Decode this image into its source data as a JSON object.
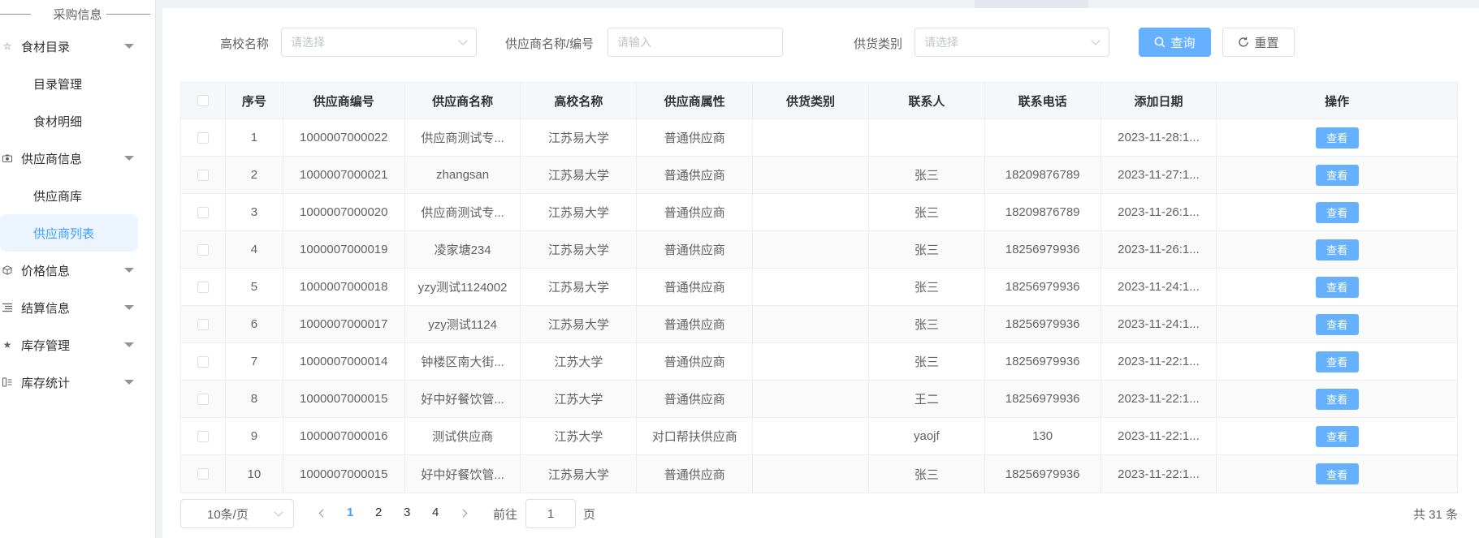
{
  "sidebar": {
    "group_title": "采购信息",
    "menus": [
      {
        "label": "食材目录",
        "icon": "star-outline-icon",
        "children": [
          "目录管理",
          "食材明细"
        ]
      },
      {
        "label": "供应商信息",
        "icon": "camera-icon",
        "children": [
          "供应商库",
          "供应商列表"
        ]
      },
      {
        "label": "价格信息",
        "icon": "cube-icon",
        "children": []
      },
      {
        "label": "结算信息",
        "icon": "list-icon",
        "children": []
      },
      {
        "label": "库存管理",
        "icon": "star-filled-icon",
        "children": []
      },
      {
        "label": "库存统计",
        "icon": "chart-icon",
        "children": []
      }
    ],
    "active_item": "供应商列表"
  },
  "filters": {
    "school_label": "高校名称",
    "school_placeholder": "请选择",
    "supplier_label": "供应商名称/编号",
    "supplier_placeholder": "请输入",
    "category_label": "供货类别",
    "category_placeholder": "请选择",
    "query_label": "查询",
    "reset_label": "重置"
  },
  "table": {
    "headers": [
      "序号",
      "供应商编号",
      "供应商名称",
      "高校名称",
      "供应商属性",
      "供货类别",
      "联系人",
      "联系电话",
      "添加日期",
      "操作"
    ],
    "action_label": "查看",
    "rows": [
      [
        "1",
        "1000007000022",
        "供应商测试专...",
        "江苏易大学",
        "普通供应商",
        "",
        "",
        "",
        "2023-11-28:1..."
      ],
      [
        "2",
        "1000007000021",
        "zhangsan",
        "江苏易大学",
        "普通供应商",
        "",
        "张三",
        "18209876789",
        "2023-11-27:1..."
      ],
      [
        "3",
        "1000007000020",
        "供应商测试专...",
        "江苏易大学",
        "普通供应商",
        "",
        "张三",
        "18209876789",
        "2023-11-26:1..."
      ],
      [
        "4",
        "1000007000019",
        "凌家塘234",
        "江苏易大学",
        "普通供应商",
        "",
        "张三",
        "18256979936",
        "2023-11-26:1..."
      ],
      [
        "5",
        "1000007000018",
        "yzy测试1124002",
        "江苏易大学",
        "普通供应商",
        "",
        "张三",
        "18256979936",
        "2023-11-24:1..."
      ],
      [
        "6",
        "1000007000017",
        "yzy测试1124",
        "江苏易大学",
        "普通供应商",
        "",
        "张三",
        "18256979936",
        "2023-11-24:1..."
      ],
      [
        "7",
        "1000007000014",
        "钟楼区南大街...",
        "江苏大学",
        "普通供应商",
        "",
        "张三",
        "18256979936",
        "2023-11-22:1..."
      ],
      [
        "8",
        "1000007000015",
        "好中好餐饮管...",
        "江苏大学",
        "普通供应商",
        "",
        "王二",
        "18256979936",
        "2023-11-22:1..."
      ],
      [
        "9",
        "1000007000016",
        "测试供应商",
        "江苏大学",
        "对口帮扶供应商",
        "",
        "yaojf",
        "130",
        "2023-11-22:1..."
      ],
      [
        "10",
        "1000007000015",
        "好中好餐饮管...",
        "江苏易大学",
        "普通供应商",
        "",
        "张三",
        "18256979936",
        "2023-11-22:1..."
      ]
    ]
  },
  "pagination": {
    "page_size": "10条/页",
    "pages": [
      "1",
      "2",
      "3",
      "4"
    ],
    "current_page": "1",
    "goto_label": "前往",
    "goto_value": "1",
    "page_unit": "页",
    "total": "共 31 条"
  },
  "colors": {
    "primary": "#66b1ff",
    "active_text": "#409eff",
    "active_bg": "#ecf5ff"
  }
}
